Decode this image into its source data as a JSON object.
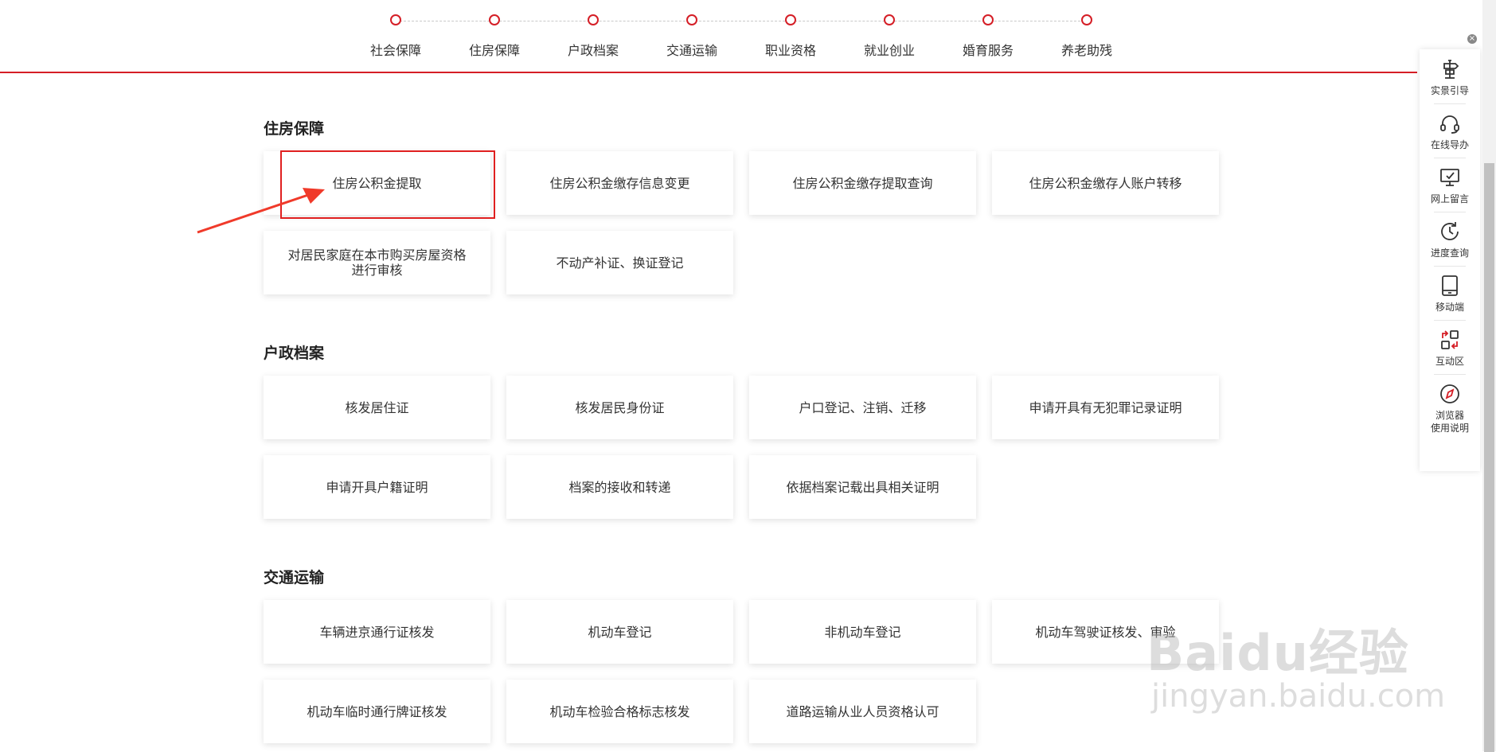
{
  "nav": {
    "steps": [
      {
        "label": "社会保障"
      },
      {
        "label": "住房保障"
      },
      {
        "label": "户政档案"
      },
      {
        "label": "交通运输"
      },
      {
        "label": "职业资格"
      },
      {
        "label": "就业创业"
      },
      {
        "label": "婚育服务"
      },
      {
        "label": "养老助残"
      }
    ]
  },
  "sections": [
    {
      "title": "住房保障",
      "items": [
        "住房公积金提取",
        "住房公积金缴存信息变更",
        "住房公积金缴存提取查询",
        "住房公积金缴存人账户转移",
        "对居民家庭在本市购买房屋资格进行审核",
        "不动产补证、换证登记"
      ]
    },
    {
      "title": "户政档案",
      "items": [
        "核发居住证",
        "核发居民身份证",
        "户口登记、注销、迁移",
        "申请开具有无犯罪记录证明",
        "申请开具户籍证明",
        "档案的接收和转递",
        "依据档案记载出具相关证明"
      ]
    },
    {
      "title": "交通运输",
      "items": [
        "车辆进京通行证核发",
        "机动车登记",
        "非机动车登记",
        "机动车驾驶证核发、审验",
        "机动车临时通行牌证核发",
        "机动车检验合格标志核发",
        "道路运输从业人员资格认可"
      ]
    }
  ],
  "side_toolbar": {
    "close_glyph": "×",
    "items": [
      {
        "label": "实景引导",
        "icon": "signpost-icon"
      },
      {
        "label": "在线导办",
        "icon": "headset-icon"
      },
      {
        "label": "网上留言",
        "icon": "message-monitor-icon"
      },
      {
        "label": "进度查询",
        "icon": "clock-refresh-icon"
      },
      {
        "label": "移动端",
        "icon": "tablet-icon"
      },
      {
        "label": "互动区",
        "icon": "interact-icon"
      },
      {
        "label": "浏览器\n使用说明",
        "icon": "compass-icon"
      }
    ]
  },
  "watermark": {
    "logo": "Baidu经验",
    "url": "jingyan.baidu.com"
  },
  "colors": {
    "accent": "#d51e26",
    "annotation": "#e02020",
    "text": "#333333"
  }
}
